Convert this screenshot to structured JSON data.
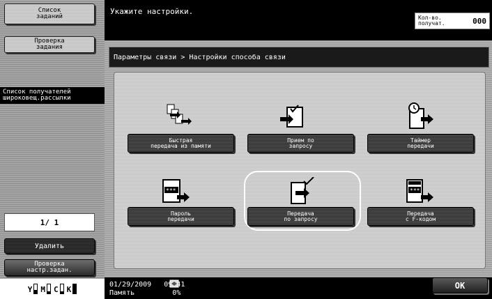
{
  "sidebar": {
    "job_list": "Список\nзаданий",
    "check_job": "Проверка\nзадания",
    "broadcast": "Список получателей\nшироковещ.рассылки",
    "page": "1/  1",
    "delete": "Удалить",
    "check_settings": "Проверка\nнастр.задан.",
    "toner": [
      {
        "label": "Y",
        "level": 0.35
      },
      {
        "label": "M",
        "level": 0.2
      },
      {
        "label": "C",
        "level": 0.2
      },
      {
        "label": "K",
        "level": 1.0
      }
    ]
  },
  "header": {
    "prompt": "Укажите настройки.",
    "recipients_label": "Кол-во.\nполучат.",
    "recipients_count": "000"
  },
  "breadcrumb": "Параметры связи > Настройки способа связи",
  "modes": [
    {
      "label": "Быстрая\nпередача из памяти",
      "icon": "quick-memory-tx-icon"
    },
    {
      "label": "Прием по\nзапросу",
      "icon": "polling-rx-icon"
    },
    {
      "label": "Таймер\nпередачи",
      "icon": "timer-tx-icon"
    },
    {
      "label": "Пароль\nпередачи",
      "icon": "password-tx-icon"
    },
    {
      "label": "Передача\nпо запросу",
      "icon": "polling-tx-icon",
      "selected": true
    },
    {
      "label": "Передача\nс F-кодом",
      "icon": "f-code-tx-icon"
    }
  ],
  "footer": {
    "datetime": "01/29/2009   09:41\nПамять         0%",
    "ok": "OK"
  },
  "colors": {
    "background": "#000000",
    "panel": "#a8a8a8",
    "button": "#3a3a3a",
    "text_light": "#ffffff"
  }
}
